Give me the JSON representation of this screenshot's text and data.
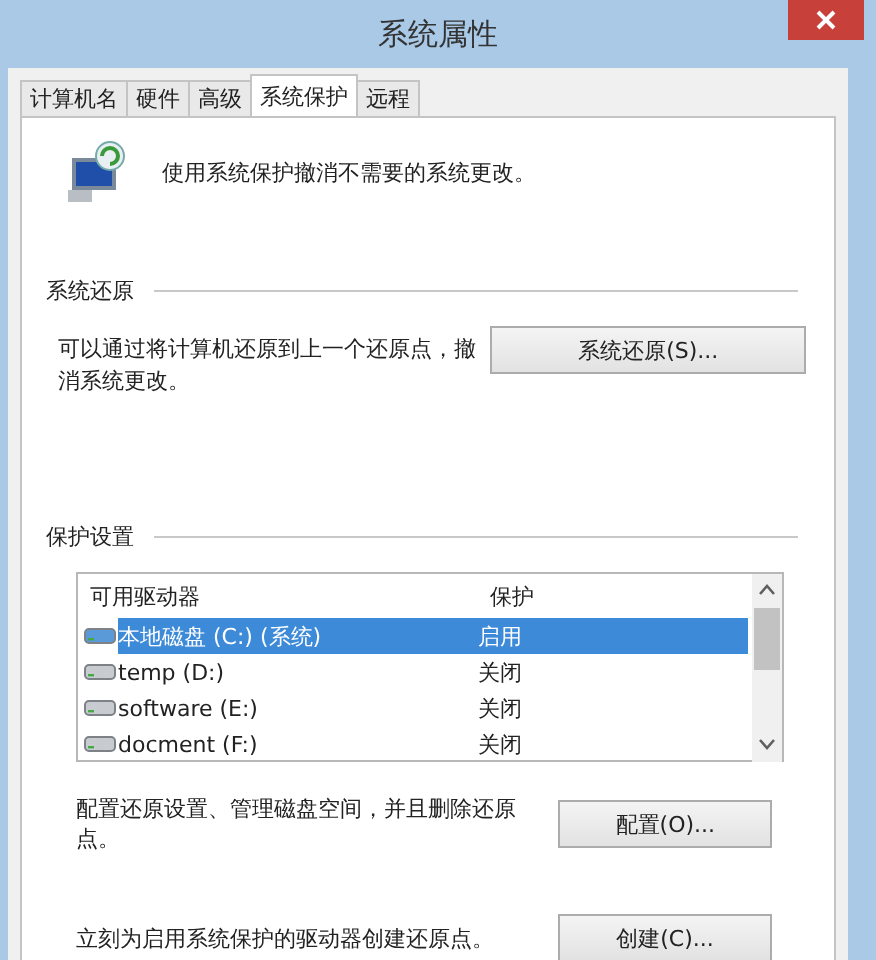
{
  "window": {
    "title": "系统属性"
  },
  "tabs": [
    {
      "label": "计算机名",
      "selected": false
    },
    {
      "label": "硬件",
      "selected": false
    },
    {
      "label": "高级",
      "selected": false
    },
    {
      "label": "系统保护",
      "selected": true
    },
    {
      "label": "远程",
      "selected": false
    }
  ],
  "intro": "使用系统保护撤消不需要的系统更改。",
  "restore": {
    "heading": "系统还原",
    "text": "可以通过将计算机还原到上一个还原点，撤消系统更改。",
    "button": "系统还原(S)..."
  },
  "protection": {
    "heading": "保护设置",
    "columns": [
      "可用驱动器",
      "保护"
    ],
    "rows": [
      {
        "kind": "system",
        "name": "本地磁盘 (C:) (系统)",
        "status": "启用",
        "selected": true
      },
      {
        "kind": "drive",
        "name": "temp (D:)",
        "status": "关闭",
        "selected": false
      },
      {
        "kind": "drive",
        "name": "software (E:)",
        "status": "关闭",
        "selected": false
      },
      {
        "kind": "drive",
        "name": "docment (F:)",
        "status": "关闭",
        "selected": false
      }
    ],
    "configure": {
      "text": "配置还原设置、管理磁盘空间，并且删除还原点。",
      "button": "配置(O)..."
    },
    "create": {
      "text": "立刻为启用系统保护的驱动器创建还原点。",
      "button": "创建(C)..."
    }
  }
}
